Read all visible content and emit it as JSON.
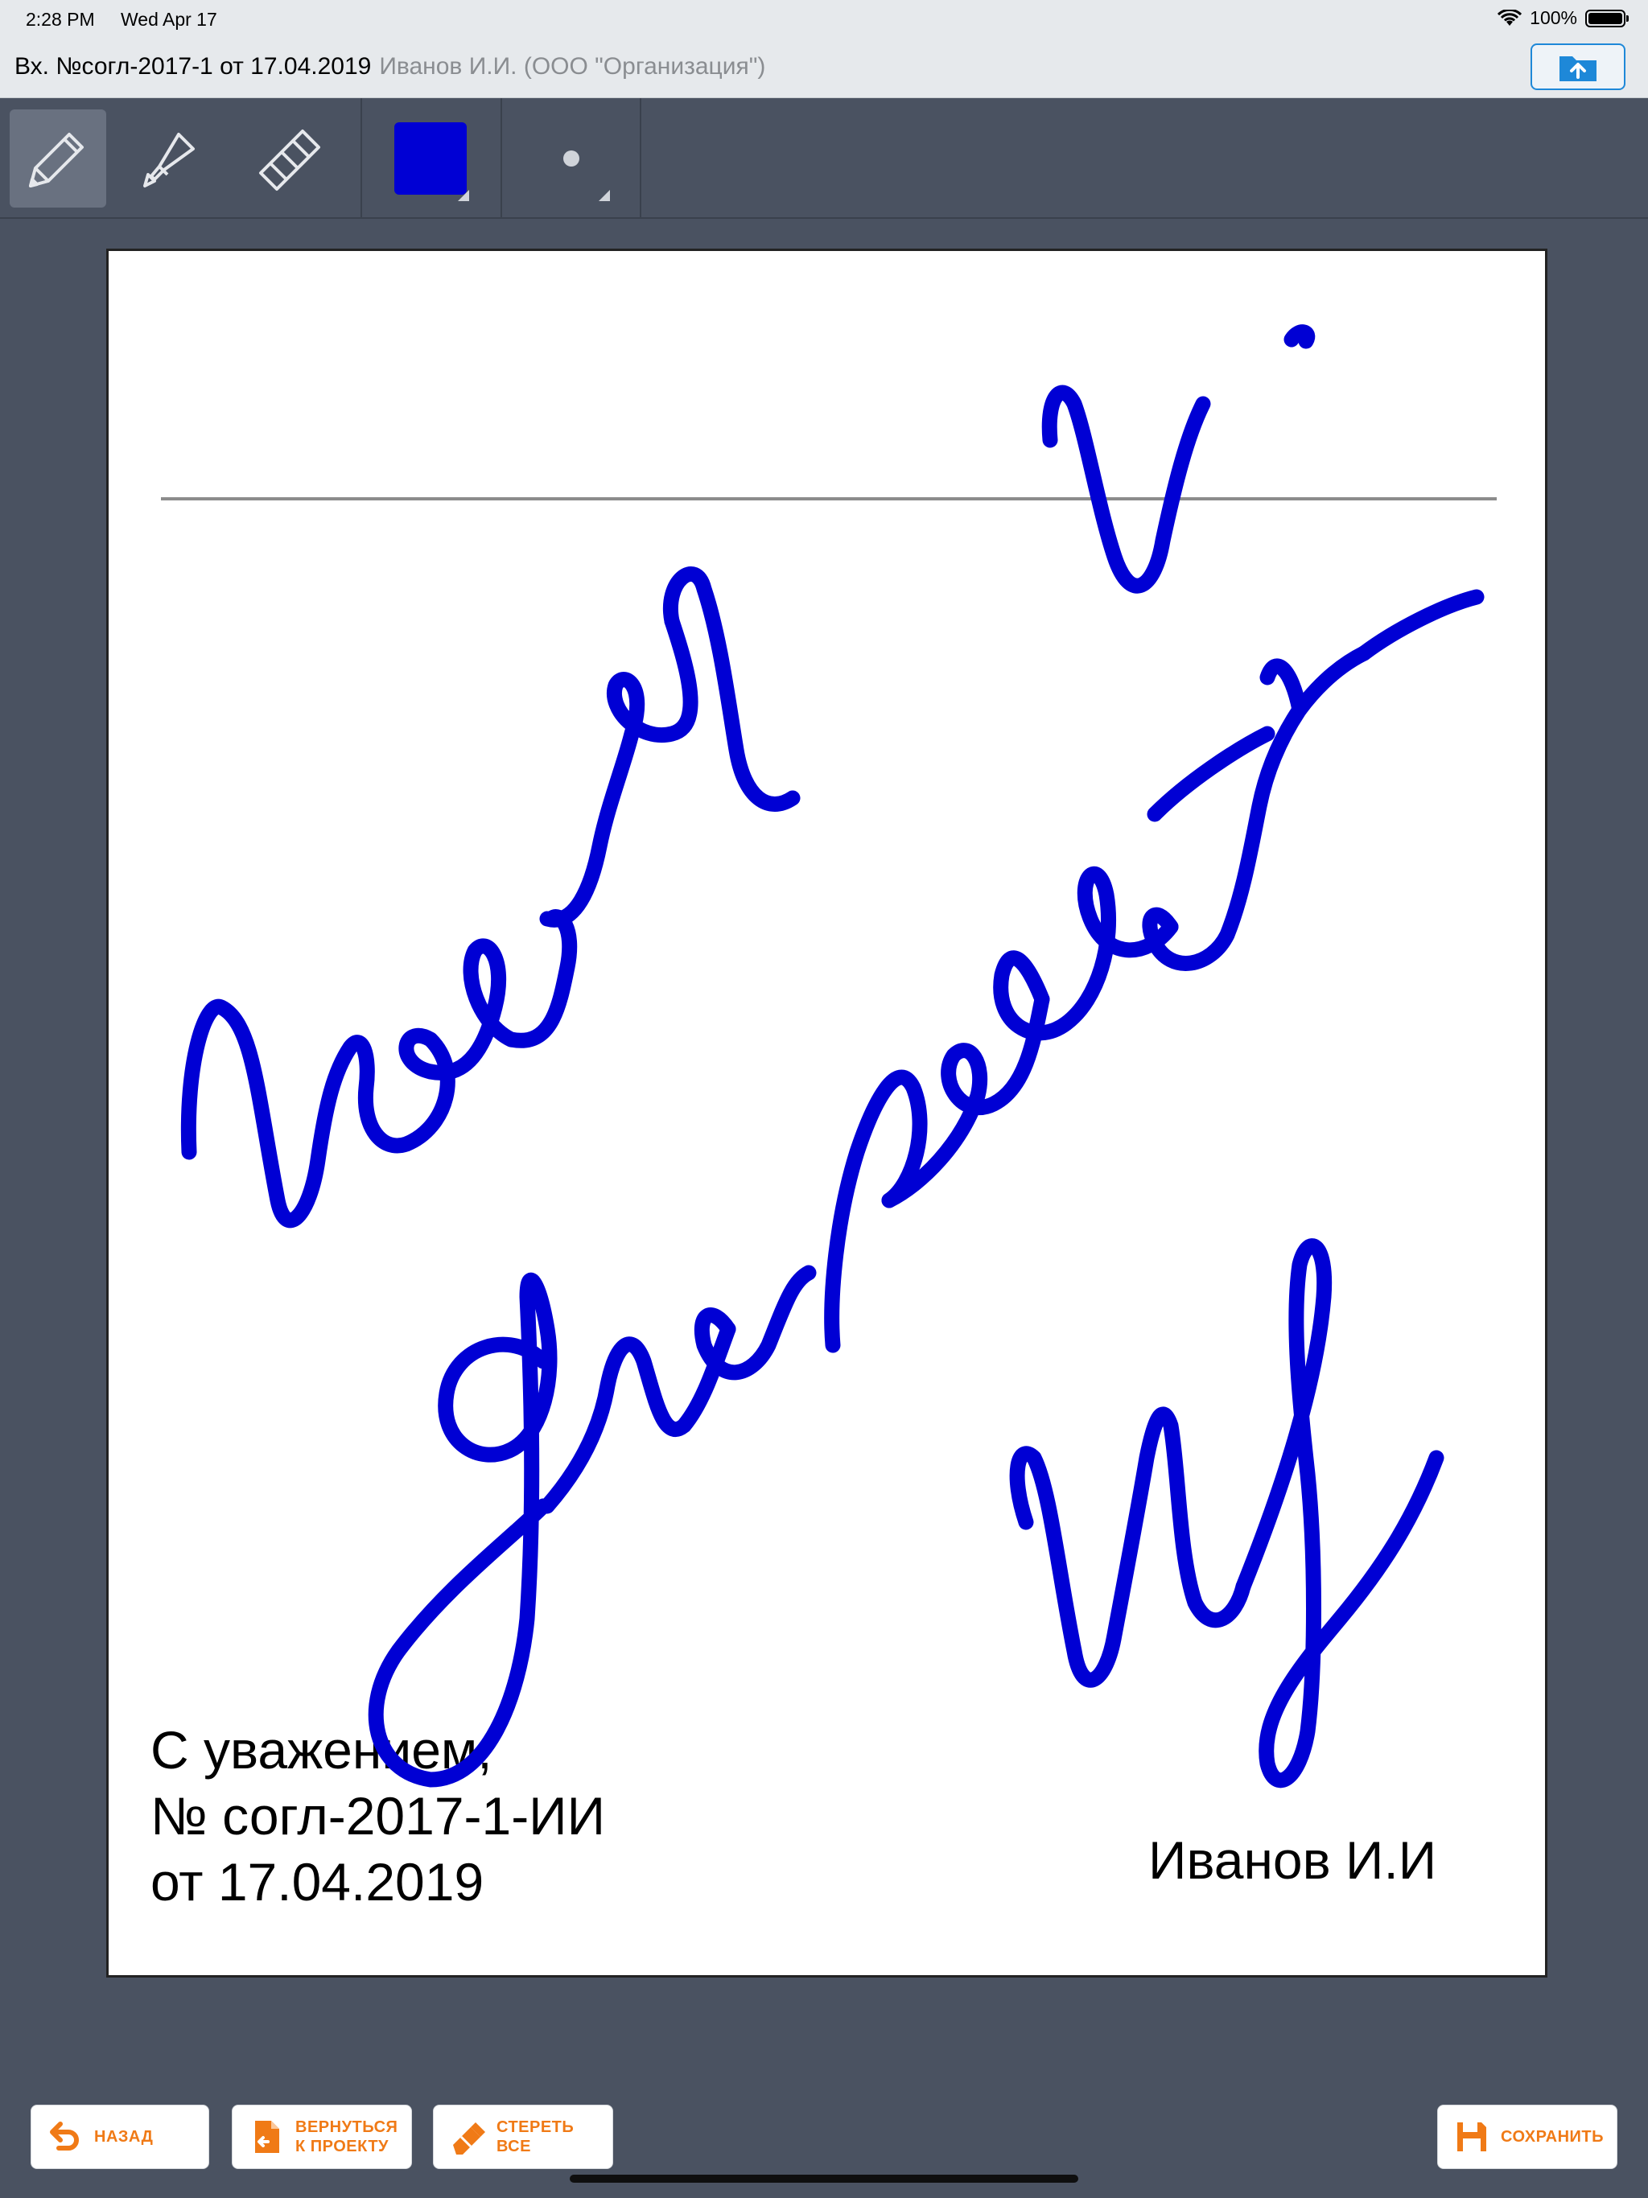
{
  "status_bar": {
    "time": "2:28 PM",
    "date": "Wed Apr 17",
    "battery": "100%"
  },
  "title_bar": {
    "doc_name": "Вх. №согл-2017-1 от 17.04.2019",
    "doc_owner": "Иванов И.И. (ООО \"Организация\")"
  },
  "toolbar": {
    "pen_color": "#0000d4",
    "tools": [
      "pencil-icon",
      "highlighter-icon",
      "eraser-icon"
    ]
  },
  "document": {
    "closing_line1": "С уважением,",
    "closing_line2": "№ согл-2017-1-ИИ",
    "closing_line3": "от 17.04.2019",
    "signer": "Иванов И.И"
  },
  "bottom_bar": {
    "back_label": "НАЗАД",
    "return_label": "ВЕРНУТЬСЯ\nК ПРОЕКТУ",
    "erase_label": "СТЕРЕТЬ\nВСЕ",
    "save_label": "СОХРАНИТЬ",
    "accent_color": "#f07a16"
  }
}
